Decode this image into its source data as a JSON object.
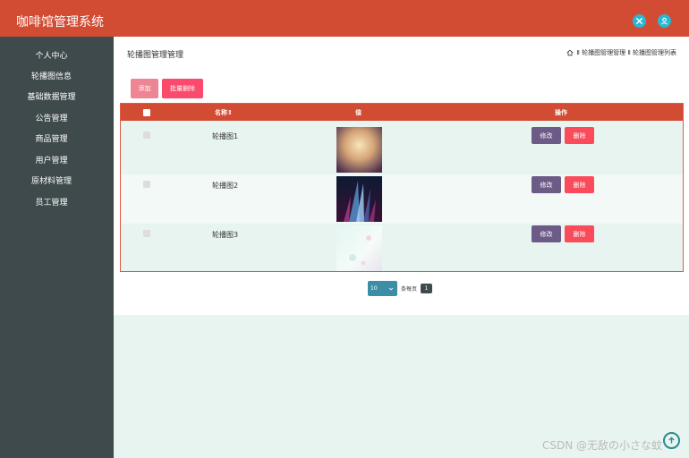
{
  "app": {
    "title": "咖啡馆管理系统"
  },
  "header_icons": [
    "tools-icon",
    "user-icon"
  ],
  "sidebar": {
    "items": [
      {
        "label": "个人中心"
      },
      {
        "label": "轮播图信息"
      },
      {
        "label": "基础数据管理"
      },
      {
        "label": "公告管理"
      },
      {
        "label": "商品管理"
      },
      {
        "label": "用户管理"
      },
      {
        "label": "原材料管理"
      },
      {
        "label": "员工管理"
      }
    ]
  },
  "page": {
    "title": "轮播图管理管理",
    "breadcrumb": "Ⅱ 轮播图管理管理 Ⅱ 轮播图管理列表"
  },
  "toolbar": {
    "add_label": "添加",
    "batch_delete_label": "批量删除"
  },
  "table": {
    "headers": {
      "name": "名称",
      "sort_mark": "⇕",
      "value": "值",
      "actions": "操作"
    },
    "rows": [
      {
        "name": "轮播图1",
        "edit": "修改",
        "delete": "删除"
      },
      {
        "name": "轮播图2",
        "edit": "修改",
        "delete": "删除"
      },
      {
        "name": "轮播图3",
        "edit": "修改",
        "delete": "删除"
      }
    ]
  },
  "pagination": {
    "page_size": "10",
    "per_page_label": "条每页",
    "current_page": "1"
  },
  "watermark": "CSDN @无敌の小さな蚊",
  "colors": {
    "header": "#d24b33",
    "sidebar": "#3f4a4d",
    "accent": "#27b8d4"
  }
}
